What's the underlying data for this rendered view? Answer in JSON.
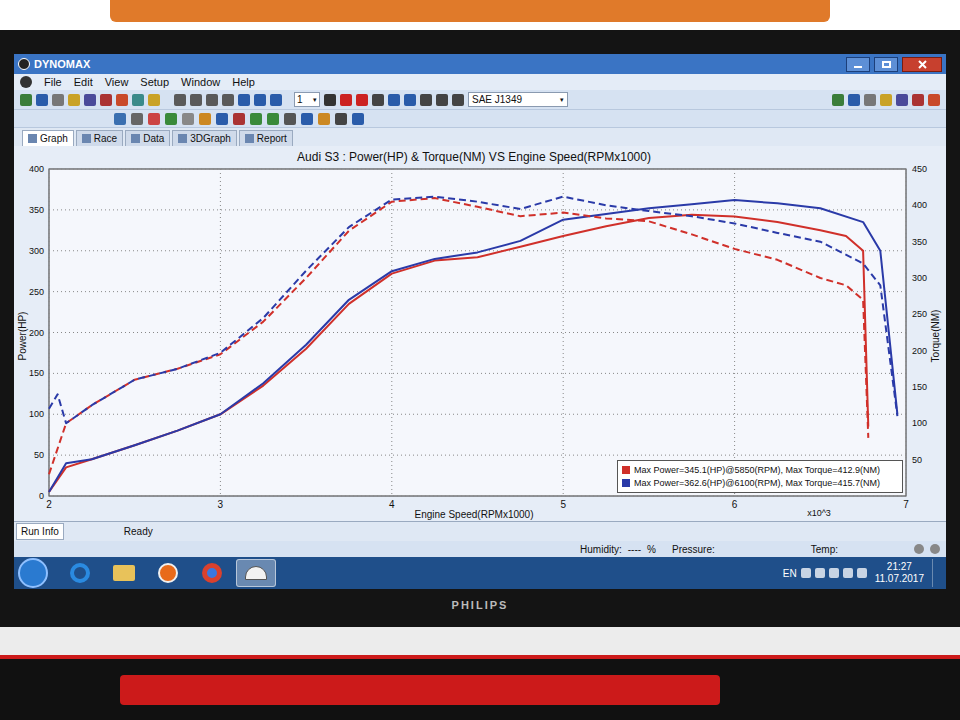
{
  "window": {
    "title": "DYNOMAX"
  },
  "menu": [
    "File",
    "Edit",
    "View",
    "Setup",
    "Window",
    "Help"
  ],
  "toolbar": {
    "page": "1",
    "standard": "SAE J1349"
  },
  "tabs": [
    {
      "label": "Graph",
      "selected": true
    },
    {
      "label": "Race",
      "selected": false
    },
    {
      "label": "Data",
      "selected": false
    },
    {
      "label": "3DGraph",
      "selected": false
    },
    {
      "label": "Report",
      "selected": false
    }
  ],
  "chart": {
    "title": "Audi S3 : Power(HP) & Torque(NM) VS Engine Speed(RPMx1000)",
    "x_label": "Engine Speed(RPMx1000)",
    "x_multiplier": "x10^3",
    "y_left_label": "Power(HP)",
    "y_right_label": "Torque(NM)",
    "x_ticks": [
      "2",
      "3",
      "4",
      "5",
      "6",
      "7"
    ],
    "y_left_ticks": [
      "0",
      "50",
      "100",
      "150",
      "200",
      "250",
      "300",
      "350",
      "400"
    ],
    "y_right_ticks": [
      "50",
      "100",
      "150",
      "200",
      "250",
      "300",
      "350",
      "400",
      "450"
    ],
    "series": [
      {
        "name": "run-1-power",
        "axis": "left",
        "kind": "solid",
        "color": "#d0302a",
        "rpm": [
          2.0,
          2.1,
          2.25,
          2.5,
          2.75,
          3.0,
          3.25,
          3.5,
          3.75,
          4.0,
          4.25,
          4.5,
          4.75,
          5.0,
          5.25,
          5.5,
          5.75,
          6.0,
          6.25,
          6.5,
          6.65,
          6.75,
          6.78
        ],
        "values": [
          5,
          35,
          45,
          62,
          80,
          100,
          135,
          180,
          235,
          272,
          288,
          292,
          305,
          318,
          330,
          340,
          344,
          342,
          335,
          325,
          318,
          300,
          85
        ]
      },
      {
        "name": "run-2-power",
        "axis": "left",
        "kind": "solid",
        "color": "#2a3aa8",
        "rpm": [
          2.0,
          2.1,
          2.25,
          2.5,
          2.75,
          3.0,
          3.25,
          3.5,
          3.75,
          4.0,
          4.25,
          4.5,
          4.75,
          5.0,
          5.25,
          5.5,
          5.75,
          6.0,
          6.25,
          6.5,
          6.75,
          6.85,
          6.95
        ],
        "values": [
          5,
          40,
          45,
          62,
          80,
          100,
          138,
          185,
          240,
          275,
          290,
          298,
          312,
          338,
          345,
          352,
          357,
          362,
          358,
          352,
          335,
          300,
          100
        ]
      },
      {
        "name": "run-1-torque",
        "axis": "right",
        "kind": "dashed",
        "color": "#d0302a",
        "rpm": [
          2.0,
          2.1,
          2.25,
          2.5,
          2.75,
          3.0,
          3.25,
          3.5,
          3.75,
          4.0,
          4.25,
          4.5,
          4.75,
          5.0,
          5.25,
          5.5,
          5.75,
          6.0,
          6.25,
          6.5,
          6.65,
          6.75,
          6.78
        ],
        "values": [
          30,
          100,
          125,
          160,
          175,
          195,
          240,
          300,
          365,
          405,
          410,
          398,
          385,
          390,
          382,
          378,
          360,
          340,
          325,
          300,
          290,
          270,
          80
        ]
      },
      {
        "name": "run-2-torque",
        "axis": "right",
        "kind": "dashed",
        "color": "#2a3aa8",
        "rpm": [
          2.0,
          2.05,
          2.1,
          2.25,
          2.5,
          2.75,
          3.0,
          3.25,
          3.5,
          3.75,
          4.0,
          4.25,
          4.5,
          4.75,
          5.0,
          5.25,
          5.5,
          5.75,
          6.0,
          6.25,
          6.5,
          6.75,
          6.85,
          6.95
        ],
        "values": [
          120,
          140,
          100,
          125,
          160,
          175,
          197,
          245,
          310,
          370,
          408,
          412,
          405,
          395,
          412,
          400,
          392,
          385,
          375,
          362,
          350,
          320,
          290,
          110
        ]
      }
    ],
    "legend": [
      {
        "text": "Max Power=345.1(HP)@5850(RPM), Max Torque=412.9(NM)",
        "color": "#d0302a"
      },
      {
        "text": "Max Power=362.6(HP)@6100(RPM), Max Torque=415.7(NM)",
        "color": "#2a3aa8"
      }
    ]
  },
  "bottom_tabs": [
    {
      "label": "Run Info",
      "selected": true
    }
  ],
  "status_bar": {
    "state": "Ready",
    "humidity_label": "Humidity:",
    "humidity_value": "----",
    "humidity_unit": "%",
    "pressure_label": "Pressure:",
    "temp_label": "Temp:"
  },
  "taskbar": {
    "apps": [
      {
        "kind": "ie",
        "active": false
      },
      {
        "kind": "explorer",
        "active": false
      },
      {
        "kind": "media",
        "active": false
      },
      {
        "kind": "chrome",
        "active": false
      },
      {
        "kind": "dyno",
        "active": true
      }
    ],
    "language": "EN",
    "time": "21:27",
    "date": "11.07.2017"
  },
  "monitor": {
    "brand": "PHILIPS"
  }
}
